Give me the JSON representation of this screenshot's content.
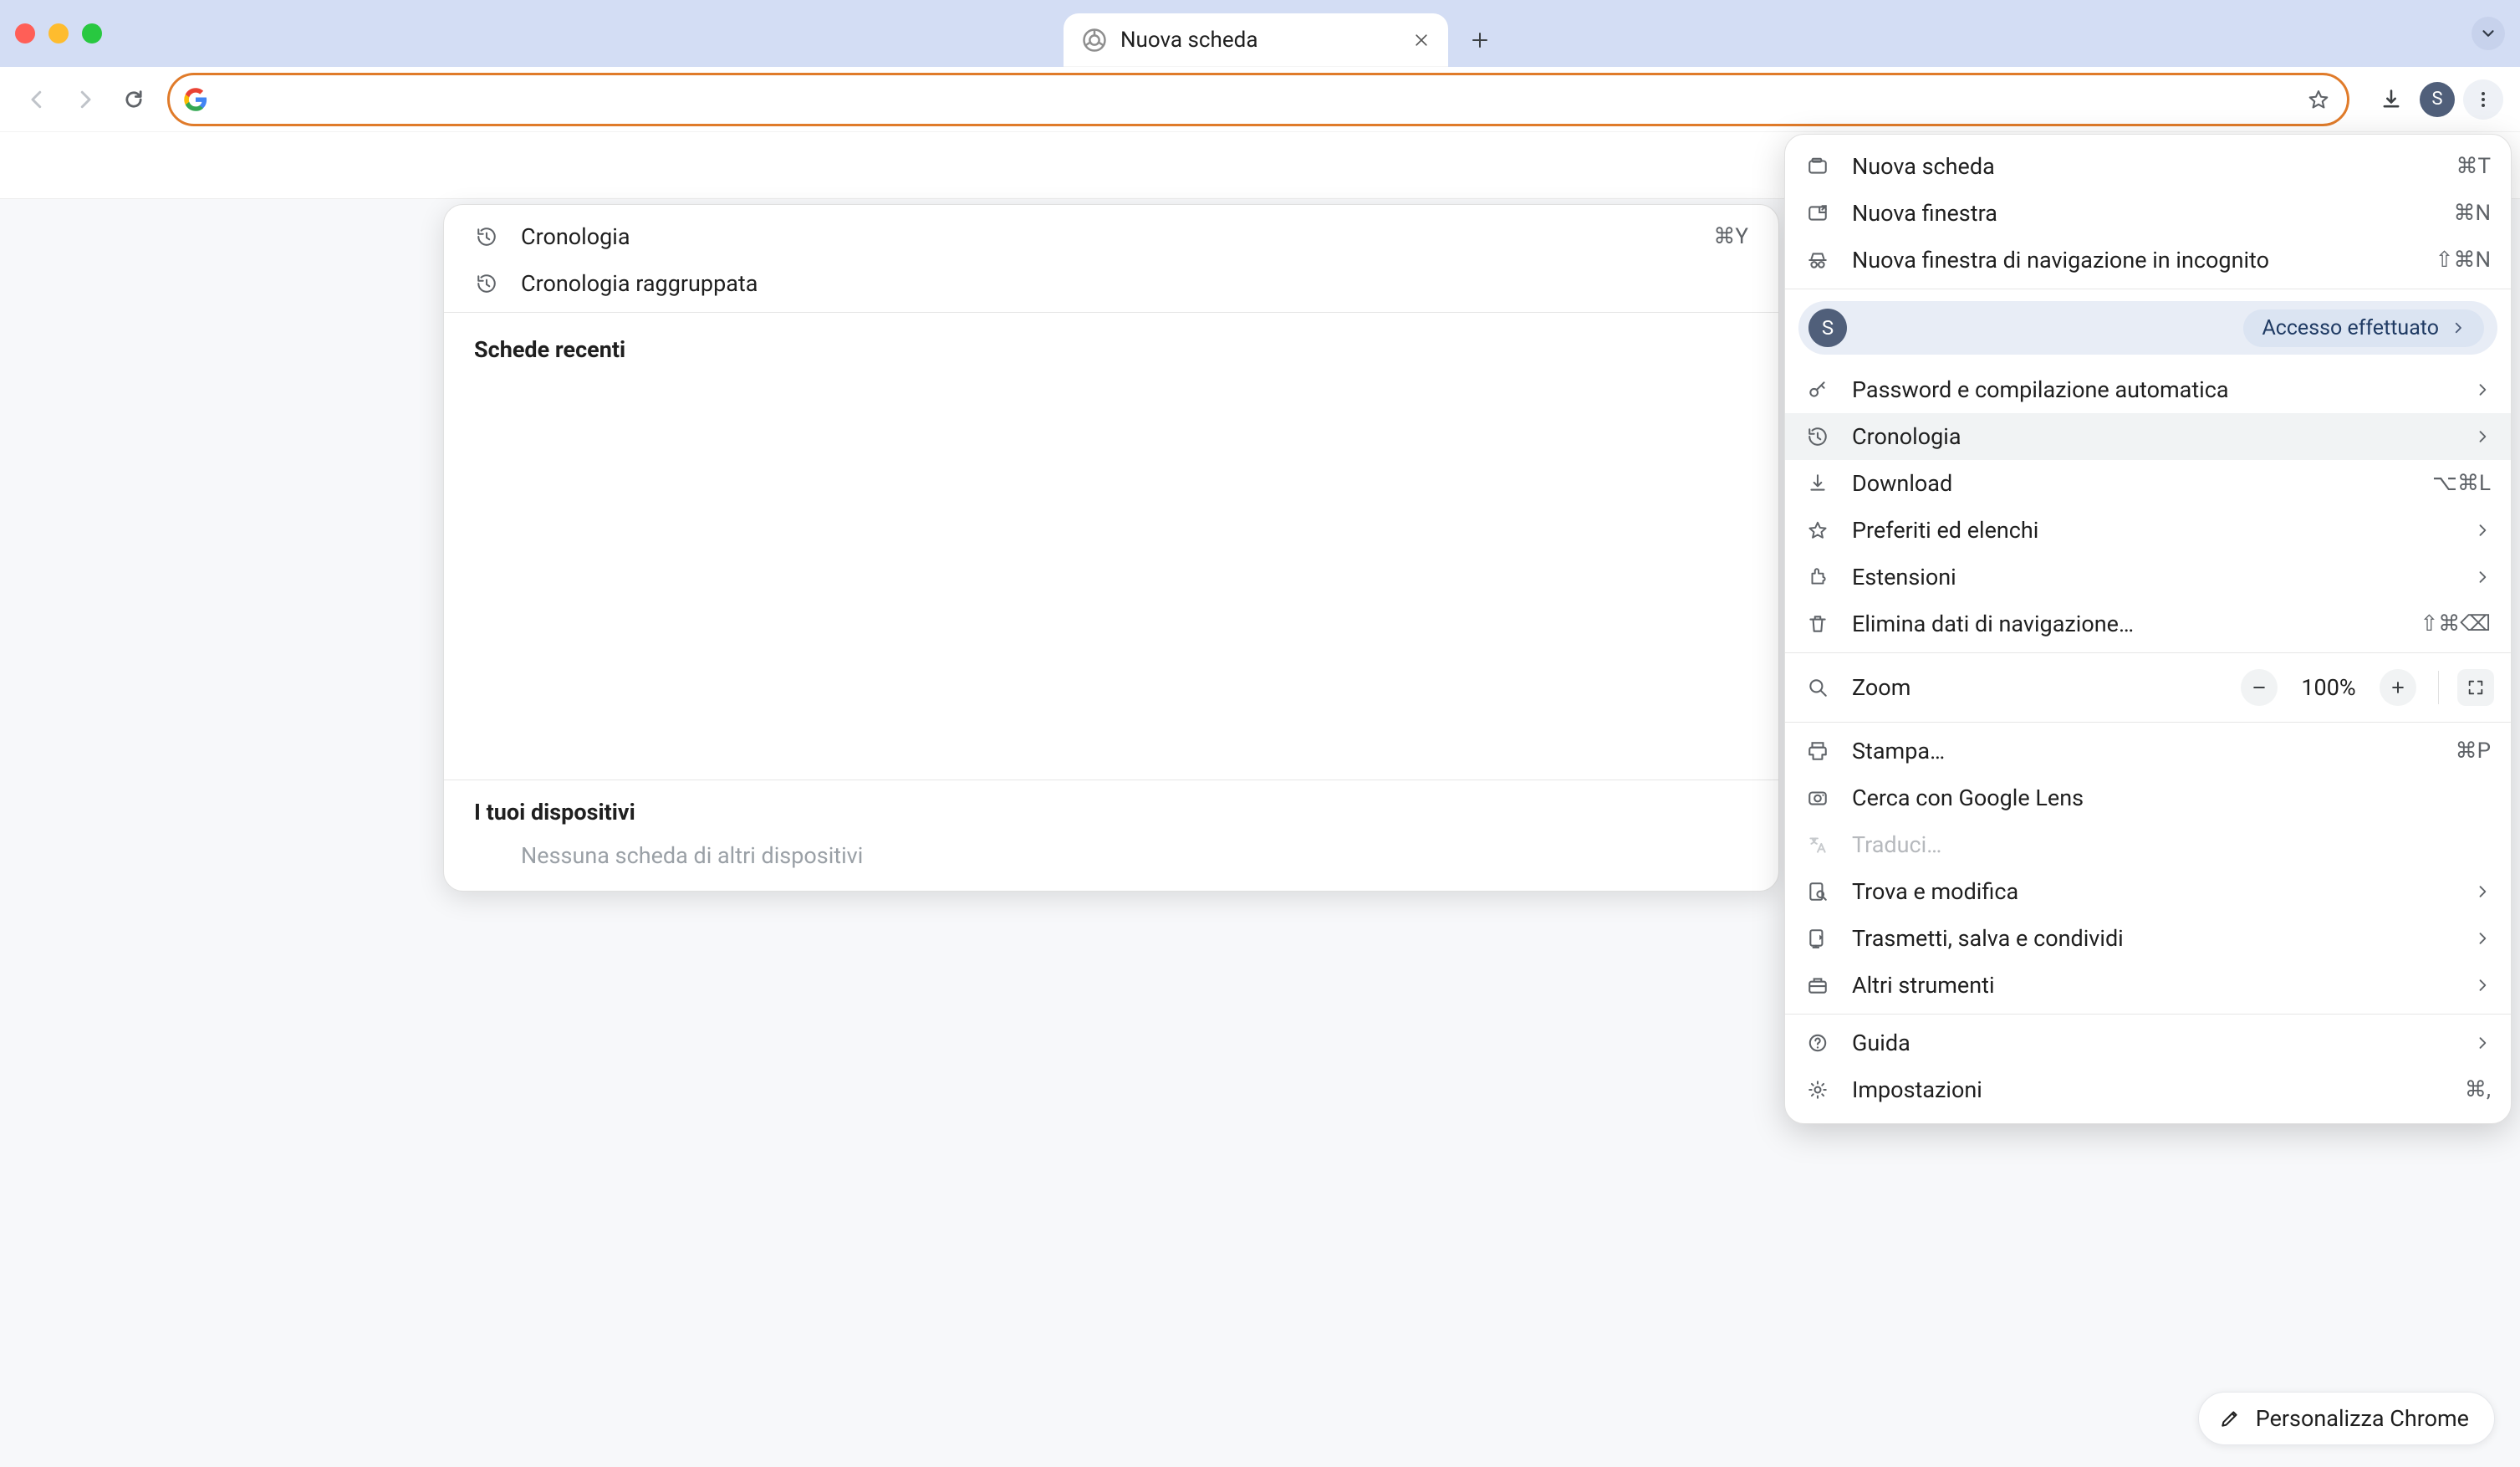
{
  "window": {
    "active_tab_title": "Nuova scheda"
  },
  "omnibox": {
    "value": ""
  },
  "avatar_letter": "S",
  "history_panel": {
    "items": [
      {
        "label": "Cronologia",
        "shortcut": "⌘Y"
      },
      {
        "label": "Cronologia raggruppata",
        "shortcut": ""
      }
    ],
    "section_recent": "Schede recenti",
    "section_devices": "I tuoi dispositivi",
    "devices_empty": "Nessuna scheda di altri dispositivi"
  },
  "main_menu": {
    "group1": [
      {
        "label": "Nuova scheda",
        "shortcut": "⌘T",
        "submenu": false,
        "icon": "tab"
      },
      {
        "label": "Nuova finestra",
        "shortcut": "⌘N",
        "submenu": false,
        "icon": "window"
      },
      {
        "label": "Nuova finestra di navigazione in incognito",
        "shortcut": "⇧⌘N",
        "submenu": false,
        "icon": "incognito"
      }
    ],
    "profile": {
      "status": "Accesso effettuato"
    },
    "group2": [
      {
        "label": "Password e compilazione automatica",
        "shortcut": "",
        "submenu": true,
        "icon": "key"
      },
      {
        "label": "Cronologia",
        "shortcut": "",
        "submenu": true,
        "icon": "history",
        "active": true
      },
      {
        "label": "Download",
        "shortcut": "⌥⌘L",
        "submenu": false,
        "icon": "download"
      },
      {
        "label": "Preferiti ed elenchi",
        "shortcut": "",
        "submenu": true,
        "icon": "star"
      },
      {
        "label": "Estensioni",
        "shortcut": "",
        "submenu": true,
        "icon": "puzzle"
      },
      {
        "label": "Elimina dati di navigazione…",
        "shortcut": "⇧⌘⌫",
        "submenu": false,
        "icon": "trash"
      }
    ],
    "zoom": {
      "label": "Zoom",
      "value": "100%"
    },
    "group3": [
      {
        "label": "Stampa…",
        "shortcut": "⌘P",
        "submenu": false,
        "icon": "print"
      },
      {
        "label": "Cerca con Google Lens",
        "shortcut": "",
        "submenu": false,
        "icon": "lens"
      },
      {
        "label": "Traduci…",
        "shortcut": "",
        "submenu": false,
        "icon": "translate",
        "disabled": true
      },
      {
        "label": "Trova e modifica",
        "shortcut": "",
        "submenu": true,
        "icon": "find"
      },
      {
        "label": "Trasmetti, salva e condividi",
        "shortcut": "",
        "submenu": true,
        "icon": "cast"
      },
      {
        "label": "Altri strumenti",
        "shortcut": "",
        "submenu": true,
        "icon": "toolbox"
      }
    ],
    "group4": [
      {
        "label": "Guida",
        "shortcut": "",
        "submenu": true,
        "icon": "help"
      },
      {
        "label": "Impostazioni",
        "shortcut": "⌘,",
        "submenu": false,
        "icon": "gear"
      }
    ]
  },
  "customize_label": "Personalizza Chrome"
}
